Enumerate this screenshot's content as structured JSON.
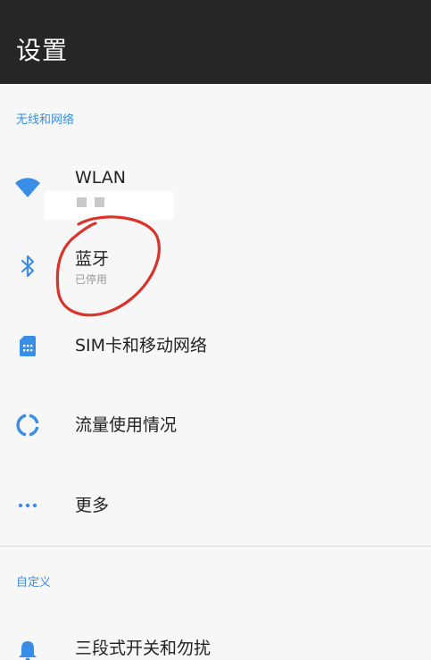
{
  "header": {
    "title": "设置"
  },
  "sections": {
    "wireless": {
      "label": "无线和网络"
    },
    "custom": {
      "label": "自定义"
    }
  },
  "items": {
    "wlan": {
      "title": "WLAN",
      "icon": "wifi-icon"
    },
    "bluetooth": {
      "title": "蓝牙",
      "subtitle": "已停用",
      "icon": "bluetooth-icon"
    },
    "sim": {
      "title": "SIM卡和移动网络",
      "icon": "sim-card-icon"
    },
    "data_usage": {
      "title": "流量使用情况",
      "icon": "data-usage-icon"
    },
    "more": {
      "title": "更多",
      "icon": "more-horizontal-icon"
    },
    "alert_slider": {
      "title": "三段式开关和勿扰",
      "icon": "bell-icon"
    }
  },
  "colors": {
    "accent": "#3a8ee6",
    "app_bar": "#262626",
    "background": "#f7f7f7",
    "annotation": "#d9342b"
  }
}
